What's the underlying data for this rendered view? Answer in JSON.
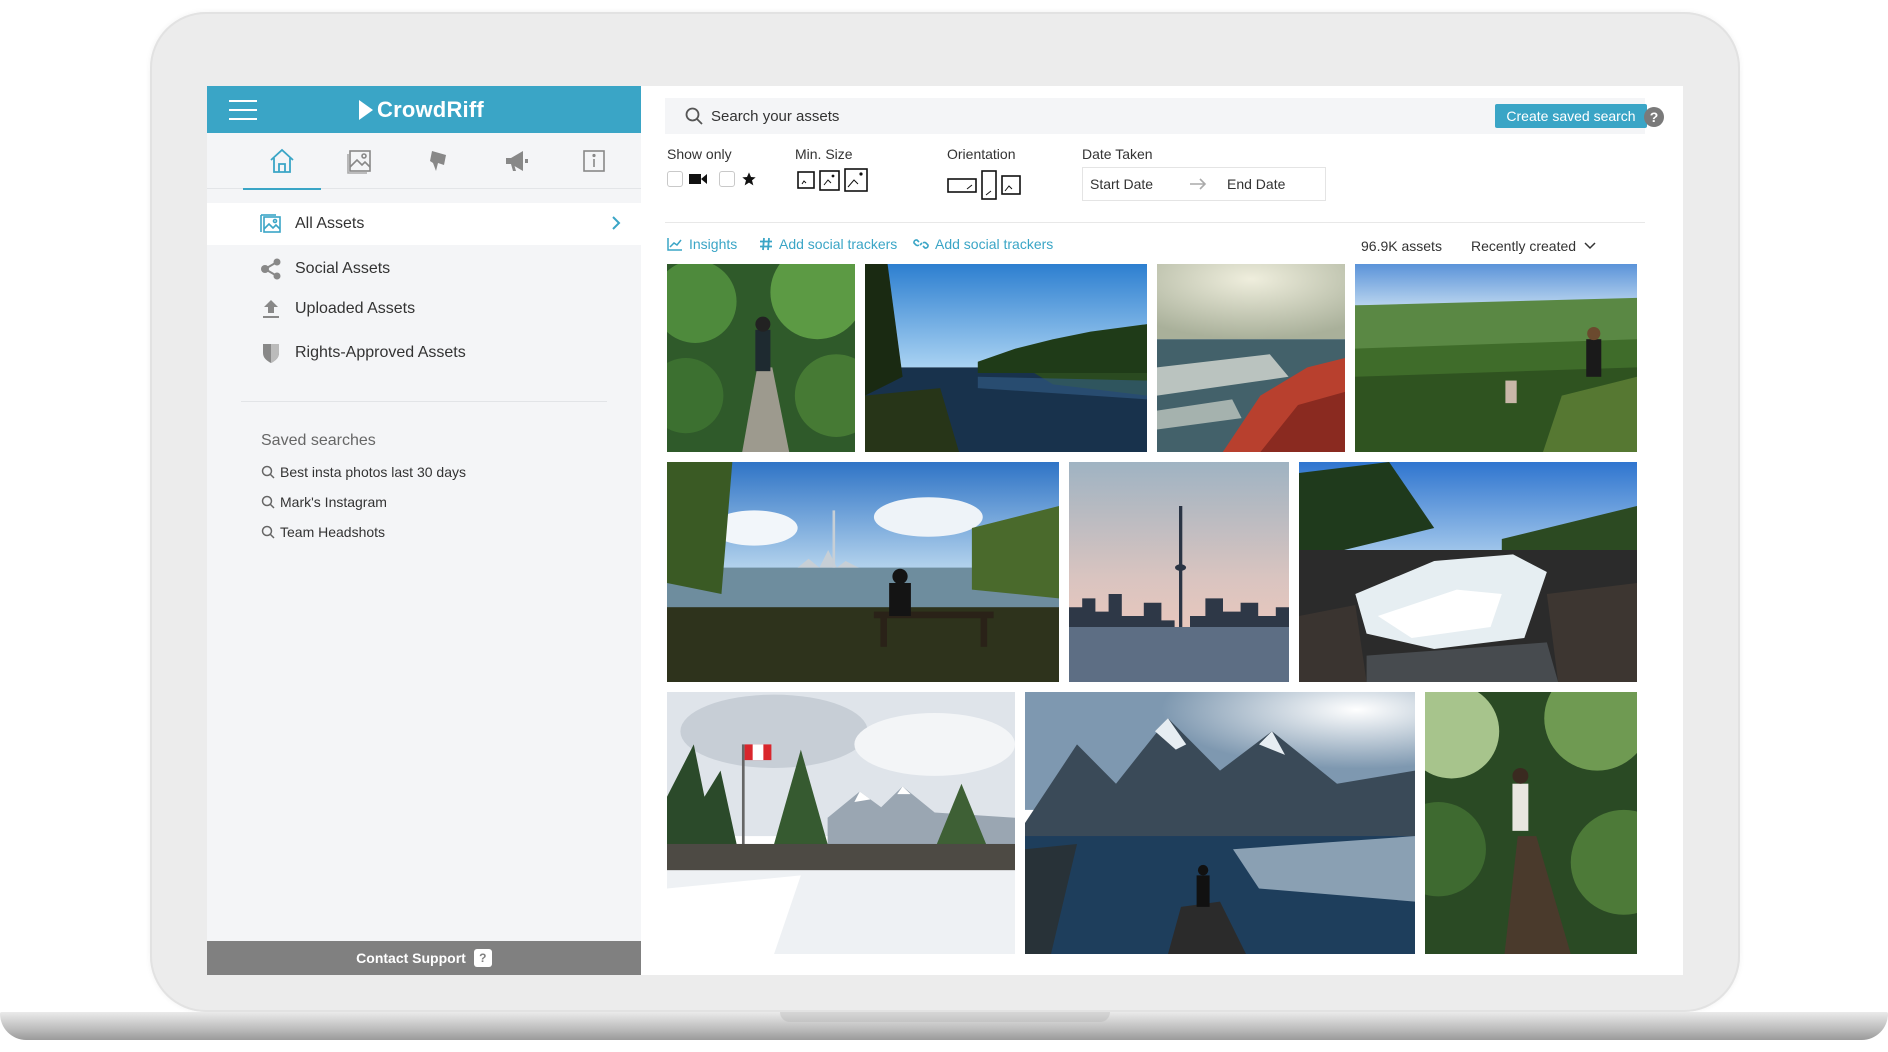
{
  "app": {
    "brand": "CrowdRiff",
    "accent_color": "#3aa5c6"
  },
  "sidebar": {
    "tabs": [
      {
        "icon": "home-icon",
        "active": true
      },
      {
        "icon": "gallery-icon",
        "active": false
      },
      {
        "icon": "stream-icon",
        "active": false
      },
      {
        "icon": "megaphone-icon",
        "active": false
      },
      {
        "icon": "info-icon",
        "active": false
      }
    ],
    "nav": [
      {
        "label": "All Assets",
        "icon": "all-assets-icon"
      },
      {
        "label": "Social Assets",
        "icon": "share-icon"
      },
      {
        "label": "Uploaded Assets",
        "icon": "upload-icon"
      },
      {
        "label": "Rights-Approved Assets",
        "icon": "shield-icon"
      }
    ],
    "saved_title": "Saved searches",
    "saved": [
      {
        "label": "Best insta photos last 30 days"
      },
      {
        "label": "Mark's Instagram"
      },
      {
        "label": "Team Headshots"
      }
    ],
    "contact": "Contact Support",
    "contact_badge": "?"
  },
  "main": {
    "search_placeholder": "Search your assets",
    "create_saved_search": "Create saved search",
    "help": "?",
    "filters": {
      "show_only": "Show only",
      "min_size": "Min. Size",
      "orientation": "Orientation",
      "date_taken": "Date Taken",
      "start_date": "Start Date",
      "end_date": "End Date"
    },
    "links": {
      "insights": "Insights",
      "hashtag_trackers": "Add social trackers",
      "link_trackers": "Add social trackers"
    },
    "asset_count": "96.9K assets",
    "sort_label": "Recently created"
  }
}
